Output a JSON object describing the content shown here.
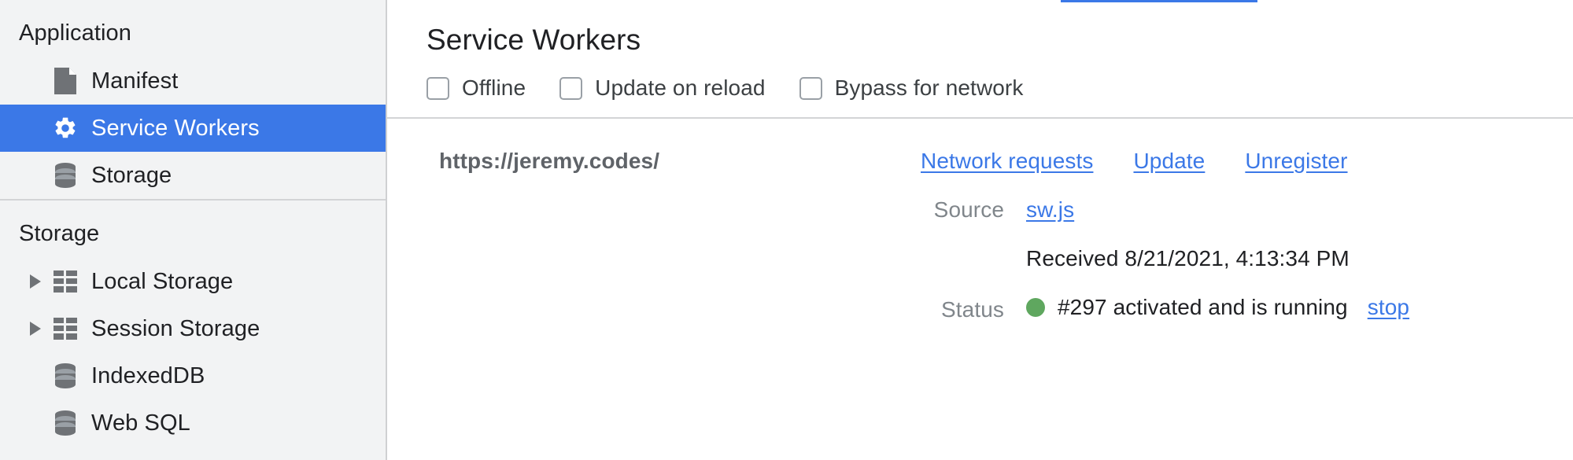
{
  "sidebar": {
    "sections": [
      {
        "title": "Application",
        "items": [
          {
            "label": "Manifest",
            "icon": "document-icon",
            "selected": false,
            "expandable": false
          },
          {
            "label": "Service Workers",
            "icon": "gear-icon",
            "selected": true,
            "expandable": false
          },
          {
            "label": "Storage",
            "icon": "database-icon",
            "selected": false,
            "expandable": false
          }
        ]
      },
      {
        "title": "Storage",
        "items": [
          {
            "label": "Local Storage",
            "icon": "table-icon",
            "selected": false,
            "expandable": true
          },
          {
            "label": "Session Storage",
            "icon": "table-icon",
            "selected": false,
            "expandable": true
          },
          {
            "label": "IndexedDB",
            "icon": "database-icon",
            "selected": false,
            "expandable": false
          },
          {
            "label": "Web SQL",
            "icon": "database-icon",
            "selected": false,
            "expandable": false
          }
        ]
      }
    ]
  },
  "main": {
    "title": "Service Workers",
    "toolbar": [
      {
        "label": "Offline",
        "checked": false
      },
      {
        "label": "Update on reload",
        "checked": false
      },
      {
        "label": "Bypass for network",
        "checked": false
      }
    ],
    "worker": {
      "origin": "https://jeremy.codes/",
      "actions": [
        {
          "label": "Network requests"
        },
        {
          "label": "Update"
        },
        {
          "label": "Unregister"
        }
      ],
      "source_label": "Source",
      "source_file": "sw.js",
      "received": "Received 8/21/2021, 4:13:34 PM",
      "status_label": "Status",
      "status_text": "#297 activated and is running",
      "status_action": "stop",
      "status_color": "#5fa75f"
    }
  },
  "colors": {
    "accent": "#3b78e7",
    "sidebar_bg": "#f2f3f4",
    "link": "#3b78e7",
    "label_gray": "#80868b"
  }
}
